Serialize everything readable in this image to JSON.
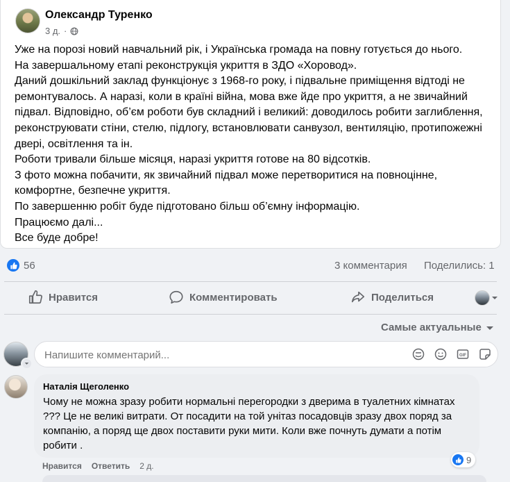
{
  "post": {
    "author": "Олександр Туренко",
    "time": "3 д.",
    "audience_icon": "globe-icon",
    "text": "Уже на порозі новий навчальний рік, і Українська громада на повну готується до нього.\nНа завершальному етапі реконструкція укриття в ЗДО «Хоровод».\nДаний дошкільний заклад функціонує з 1968-го року, і підвальне приміщення відтоді не ремонтувалось. А наразі, коли в країні війна, мова вже йде про укриття, а не звичайний підвал. Відповідно, об’єм роботи був складний і великий: доводилось робити заглиблення, реконструювати стіни, стелю, підлогу, встановлювати санвузол, вентиляцію, протипожежні двері, освітлення та ін.\nРоботи тривали більше місяця, наразі укриття готове на 80 відсотків.\nЗ фото можна побачити, як звичайний підвал може перетворитися на повноцінне, комфортне, безпечне  укриття.\nПо завершенню робіт буде підготовано більш об’ємну інформацію.\nПрацюємо далі...\nВсе буде добре!"
  },
  "stats": {
    "likes": "56",
    "comments": "3 комментария",
    "shares": "Поделились: 1"
  },
  "actions": {
    "like": "Нравится",
    "comment": "Комментировать",
    "share": "Поделиться"
  },
  "sort": {
    "label": "Самые актуальные"
  },
  "comment_box": {
    "placeholder": "Напишите комментарий..."
  },
  "comments": [
    {
      "author": "Наталія Щеголенко",
      "text": "Чому не можна зразу робити нормальні перегородки з дверима в туалетних кімнатах ??? Це не великі витрати. От посадити на той унітаз посадовців зразу двох поряд за компанію, а поряд ще двох поставити руки мити. Коли вже почнуть думати а потім робити .",
      "like_label": "Нравится",
      "reply_label": "Ответить",
      "time": "2 д.",
      "reactions": "9"
    }
  ],
  "colors": {
    "accent": "#1877f2",
    "muted_text": "#65676b",
    "background": "#f0f2f5"
  }
}
